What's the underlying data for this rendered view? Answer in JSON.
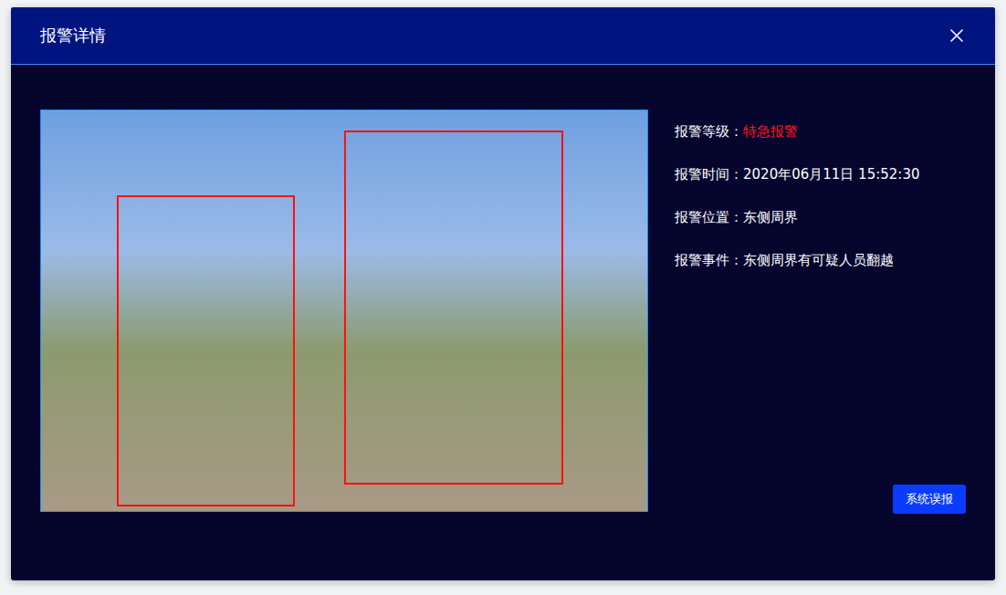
{
  "dialog": {
    "title": "报警详情"
  },
  "fields": [
    {
      "label": "报警等级：",
      "value": "特急报警",
      "color": "#ff1a1a"
    },
    {
      "label": "报警时间：",
      "value": "2020年06月11日  15:52:30",
      "color": "#ffffff"
    },
    {
      "label": "报警位置：",
      "value": "东侧周界",
      "color": "#ffffff"
    },
    {
      "label": "报警事件：",
      "value": "东侧周界有可疑人员翻越",
      "color": "#ffffff"
    }
  ],
  "buttons": [
    "系统误报"
  ]
}
